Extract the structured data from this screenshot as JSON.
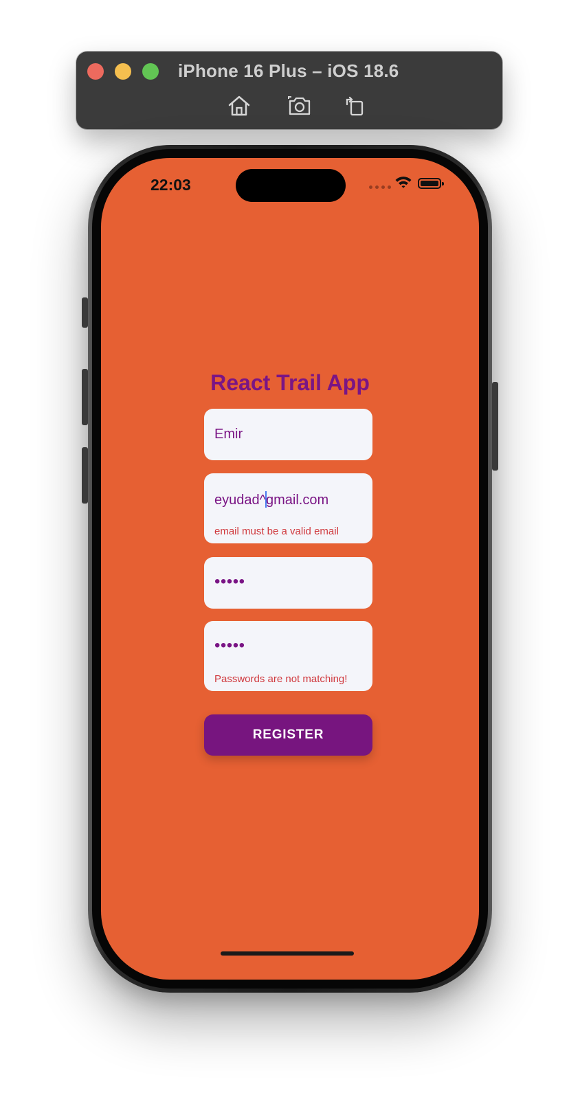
{
  "simulator": {
    "title": "iPhone 16 Plus – iOS 18.6",
    "toolbar": {
      "home_icon": "home-icon",
      "screenshot_icon": "camera-icon",
      "rotate_icon": "rotate-icon"
    },
    "traffic_lights": [
      "close",
      "minimize",
      "zoom"
    ]
  },
  "status_bar": {
    "time": "22:03",
    "wifi_icon": "wifi-icon",
    "battery_icon": "battery-icon"
  },
  "app": {
    "title": "React Trail App",
    "fields": {
      "name": {
        "value": "Emir"
      },
      "email": {
        "value_before_cursor": "eyudad^",
        "value_after_cursor": "gmail.com",
        "error": "email must be a valid email"
      },
      "password": {
        "value": "•••••"
      },
      "confirm_password": {
        "value": "•••••",
        "error": "Passwords are not matching!"
      }
    },
    "register_label": "REGISTER"
  },
  "colors": {
    "background": "#e66033",
    "accent": "#7a1585",
    "error": "#d0393e",
    "field_bg": "#f4f5fa",
    "button_bg": "#77157f"
  }
}
